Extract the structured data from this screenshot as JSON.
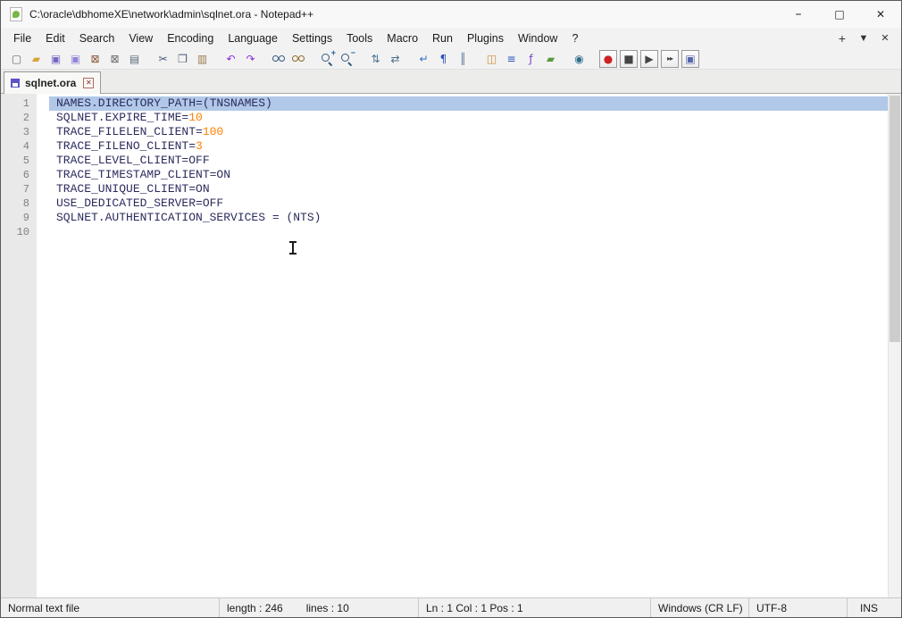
{
  "window": {
    "title": "C:\\oracle\\dbhomeXE\\network\\admin\\sqlnet.ora - Notepad++",
    "controls": {
      "minimize": "–",
      "maximize": "□",
      "close": "✕"
    }
  },
  "menu": {
    "items": [
      {
        "label": "File",
        "name": "file"
      },
      {
        "label": "Edit",
        "name": "edit"
      },
      {
        "label": "Search",
        "name": "search"
      },
      {
        "label": "View",
        "name": "view"
      },
      {
        "label": "Encoding",
        "name": "encoding"
      },
      {
        "label": "Language",
        "name": "language"
      },
      {
        "label": "Settings",
        "name": "settings"
      },
      {
        "label": "Tools",
        "name": "tools"
      },
      {
        "label": "Macro",
        "name": "macro"
      },
      {
        "label": "Run",
        "name": "run"
      },
      {
        "label": "Plugins",
        "name": "plugins"
      },
      {
        "label": "Window",
        "name": "window"
      },
      {
        "label": "?",
        "name": "help"
      }
    ],
    "right": {
      "plus": "+",
      "dropdown": "▼",
      "close": "✕"
    }
  },
  "toolbar": {
    "icons": [
      {
        "name": "new-file",
        "glyph": "▢",
        "color": "#666666"
      },
      {
        "name": "open-file",
        "glyph": "▰",
        "color": "#d9a33c"
      },
      {
        "name": "save-file",
        "glyph": "▣",
        "color": "#7668c8"
      },
      {
        "name": "save-all",
        "glyph": "▣",
        "color": "#8f84d8"
      },
      {
        "name": "close-file",
        "glyph": "⊠",
        "color": "#8a5a3a"
      },
      {
        "name": "close-all",
        "glyph": "⊠",
        "color": "#6a6a6a"
      },
      {
        "name": "print",
        "glyph": "▤",
        "color": "#5a6a7a"
      },
      {
        "name": "cut",
        "glyph": "✂",
        "color": "#4a5a7a",
        "gap": true
      },
      {
        "name": "copy",
        "glyph": "❐",
        "color": "#4a5a7a"
      },
      {
        "name": "paste",
        "glyph": "▥",
        "color": "#9a7b4f"
      },
      {
        "name": "undo",
        "glyph": "↶",
        "color": "#8a2be2",
        "gap": true
      },
      {
        "name": "redo",
        "glyph": "↷",
        "color": "#8a2be2"
      },
      {
        "name": "find",
        "shape": "binoc",
        "gap": true
      },
      {
        "name": "find-replace",
        "shape": "binoc2"
      },
      {
        "name": "zoom-in",
        "shape": "mag",
        "pm": "+",
        "gap": true
      },
      {
        "name": "zoom-out",
        "shape": "mag",
        "pm": "−"
      },
      {
        "name": "sync-vertical-scroll",
        "glyph": "⇅",
        "color": "#46708e",
        "gap": true
      },
      {
        "name": "sync-horizontal-scroll",
        "glyph": "⇄",
        "color": "#46708e"
      },
      {
        "name": "word-wrap",
        "glyph": "↵",
        "color": "#2a6fbf",
        "gap": true
      },
      {
        "name": "show-all-characters",
        "glyph": "¶",
        "color": "#2a52be"
      },
      {
        "name": "show-indent-guide",
        "glyph": "║",
        "color": "#5a7a9a"
      },
      {
        "name": "document-map",
        "glyph": "◫",
        "color": "#c98c2c",
        "gap": true
      },
      {
        "name": "document-list",
        "glyph": "≡",
        "color": "#2a52be"
      },
      {
        "name": "function-list",
        "glyph": "ƒ",
        "color": "#7a3fbf"
      },
      {
        "name": "folder-as-workspace",
        "glyph": "▰",
        "color": "#5a9a40"
      },
      {
        "name": "monitoring",
        "glyph": "◉",
        "color": "#2e6e8e",
        "gap": true
      },
      {
        "name": "macro-record",
        "glyph": "●",
        "color": "#cc2222",
        "framed": true,
        "gap": true
      },
      {
        "name": "macro-stop",
        "glyph": "■",
        "color": "#444444",
        "framed": true
      },
      {
        "name": "macro-playback",
        "glyph": "▶",
        "color": "#444444",
        "framed": true
      },
      {
        "name": "macro-run-multiple",
        "glyph": "▸▸",
        "color": "#444444",
        "framed": true,
        "small": true
      },
      {
        "name": "macro-save",
        "glyph": "▣",
        "color": "#5566aa",
        "framed": true
      }
    ]
  },
  "tabs": [
    {
      "label": "sqlnet.ora",
      "close_glyph": "✕"
    }
  ],
  "editor": {
    "colors": {
      "text": "#2b2b5e",
      "number": "#ff8000",
      "selection": "#b1c8e8",
      "line_number": "#828282"
    },
    "lines": [
      {
        "num": "1",
        "selected": true,
        "segments": [
          {
            "type": "text",
            "text": "NAMES.DIRECTORY_PATH=(TNSNAMES)"
          }
        ]
      },
      {
        "num": "2",
        "segments": [
          {
            "type": "text",
            "text": "SQLNET.EXPIRE_TIME="
          },
          {
            "type": "number",
            "text": "10"
          }
        ]
      },
      {
        "num": "3",
        "segments": [
          {
            "type": "text",
            "text": "TRACE_FILELEN_CLIENT="
          },
          {
            "type": "number",
            "text": "100"
          }
        ]
      },
      {
        "num": "4",
        "segments": [
          {
            "type": "text",
            "text": "TRACE_FILENO_CLIENT="
          },
          {
            "type": "number",
            "text": "3"
          }
        ]
      },
      {
        "num": "5",
        "segments": [
          {
            "type": "text",
            "text": "TRACE_LEVEL_CLIENT=OFF"
          }
        ]
      },
      {
        "num": "6",
        "segments": [
          {
            "type": "text",
            "text": "TRACE_TIMESTAMP_CLIENT=ON"
          }
        ]
      },
      {
        "num": "7",
        "segments": [
          {
            "type": "text",
            "text": "TRACE_UNIQUE_CLIENT=ON"
          }
        ]
      },
      {
        "num": "8",
        "segments": [
          {
            "type": "text",
            "text": "USE_DEDICATED_SERVER=OFF"
          }
        ]
      },
      {
        "num": "9",
        "segments": [
          {
            "type": "text",
            "text": "SQLNET.AUTHENTICATION_SERVICES = (NTS)"
          }
        ]
      },
      {
        "num": "10",
        "segments": []
      }
    ]
  },
  "status": {
    "doc_type": "Normal text file",
    "length_text": "length : 246",
    "lines_text": "lines : 10",
    "position_text": "Ln : 1   Col : 1   Pos : 1",
    "eol": "Windows (CR LF)",
    "encoding": "UTF-8",
    "insert_mode": "INS"
  }
}
